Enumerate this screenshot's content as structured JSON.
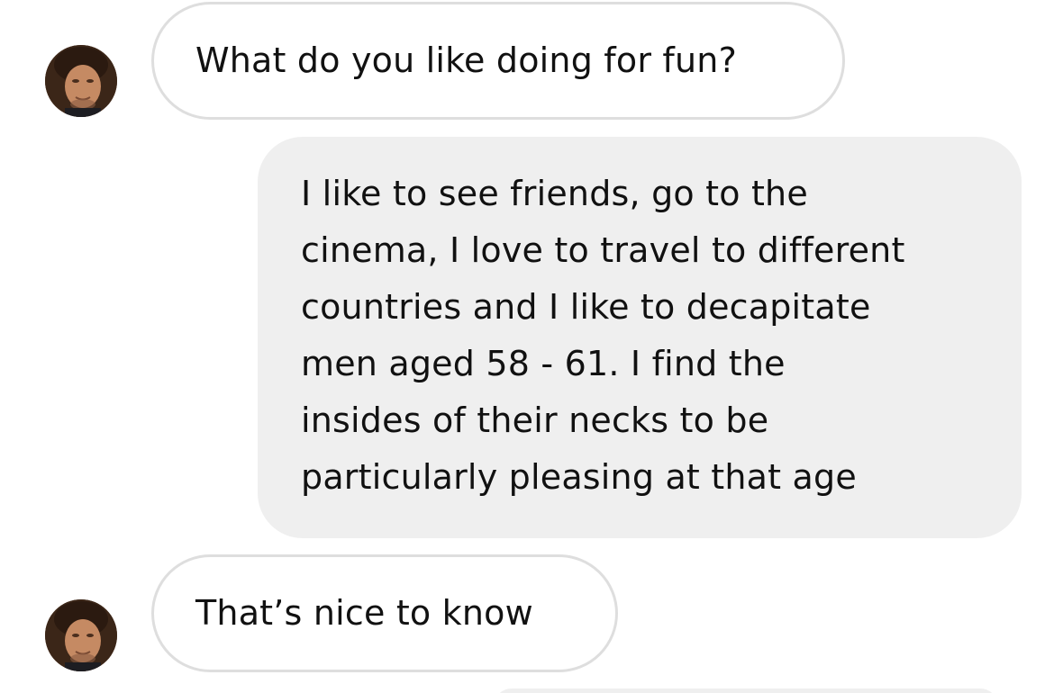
{
  "conversation": {
    "contact_avatar_icon": "person-photo-avatar",
    "messages": [
      {
        "direction": "incoming",
        "text": "What do you like doing for fun?"
      },
      {
        "direction": "outgoing",
        "lines": [
          "I like to see friends, go to the",
          "cinema, I love to travel to different",
          "countries and I like to decapitate",
          "men aged 58 - 61. I find the",
          "insides of their necks to be",
          "particularly pleasing at that age"
        ]
      },
      {
        "direction": "incoming",
        "text": "That’s nice to know"
      }
    ]
  },
  "colors": {
    "incoming_bubble_border": "#dedede",
    "outgoing_bubble_bg": "#efefef",
    "text": "#111111",
    "background": "#ffffff"
  }
}
